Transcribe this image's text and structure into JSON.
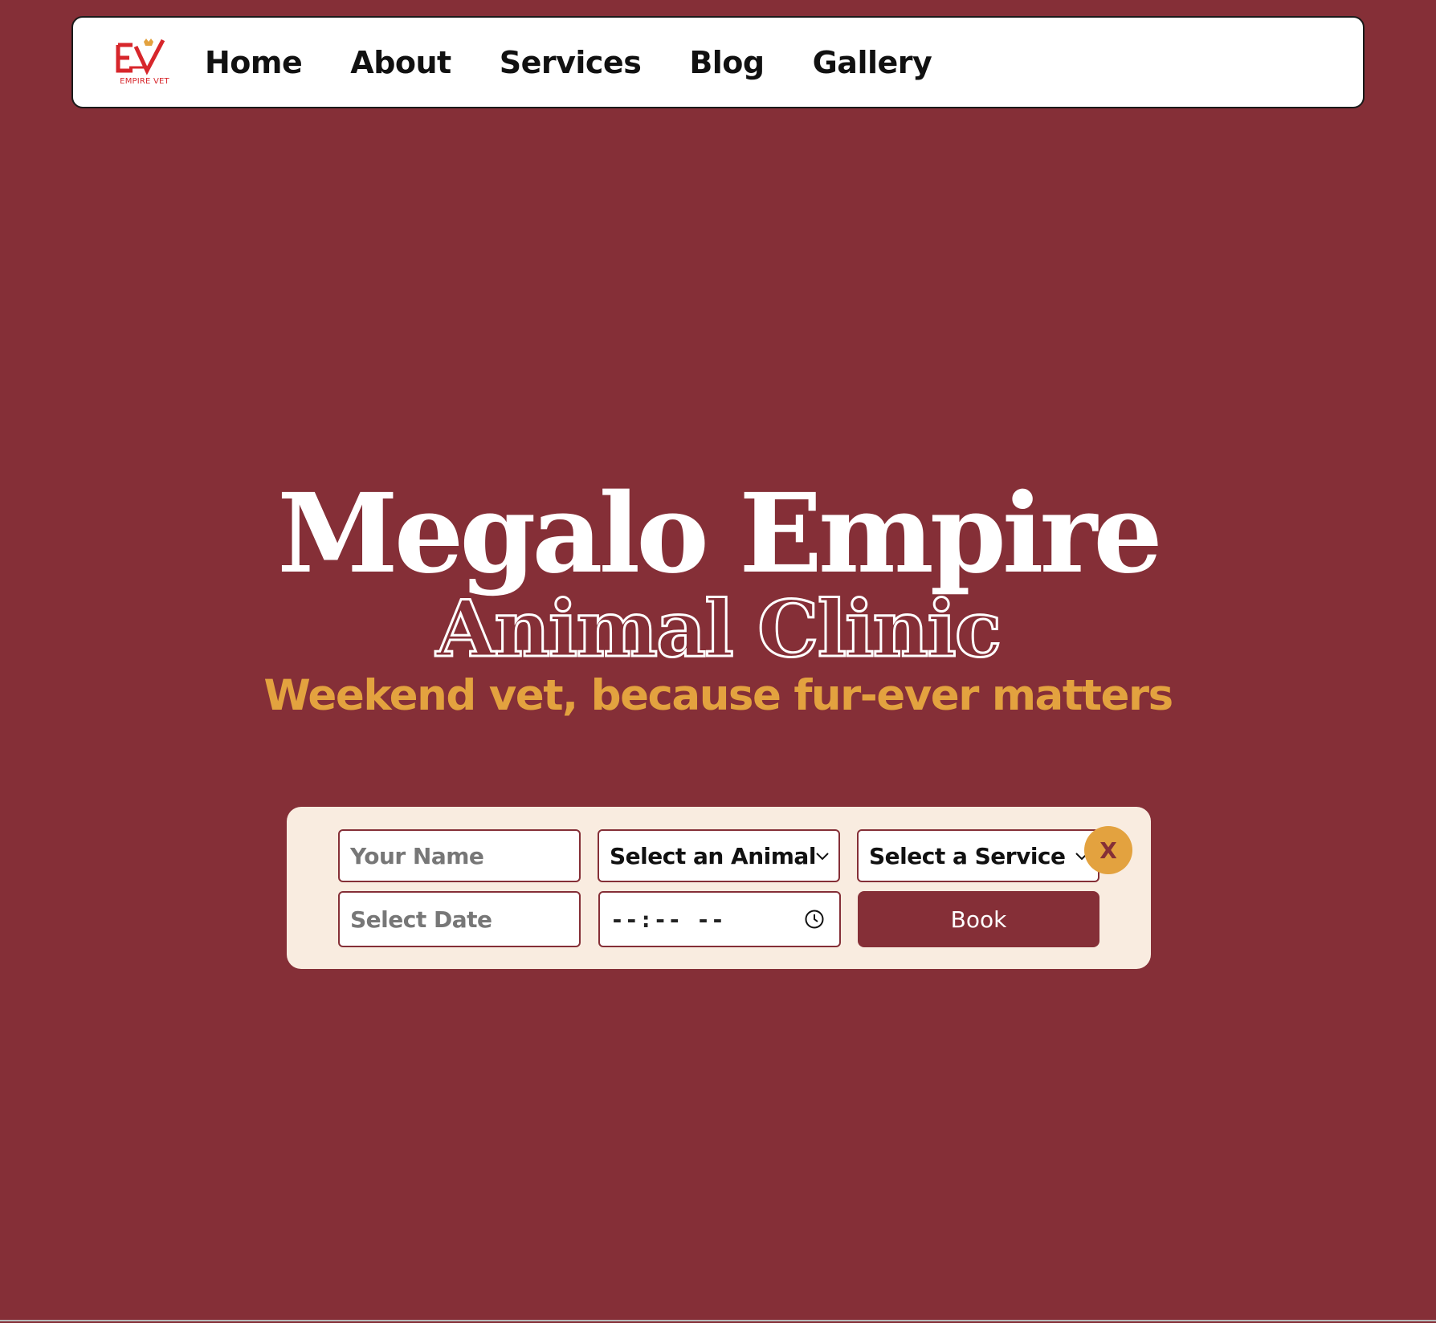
{
  "brand": {
    "logo_text": "EMPIRE VET",
    "primary_color": "#852f37",
    "accent_color": "#e3a23f",
    "logo_color": "#d7262b"
  },
  "nav": {
    "items": [
      {
        "label": "Home"
      },
      {
        "label": "About"
      },
      {
        "label": "Services"
      },
      {
        "label": "Blog"
      },
      {
        "label": "Gallery"
      }
    ]
  },
  "hero": {
    "title": "Megalo Empire",
    "subtitle": "Animal Clinic",
    "tagline": "Weekend vet, because fur-ever matters"
  },
  "booking": {
    "name_placeholder": "Your Name",
    "animal_select": "Select an Animal",
    "service_select": "Select a Service",
    "date_placeholder": "Select Date",
    "time_value": "--:-- --",
    "book_label": "Book",
    "close_label": "X"
  },
  "icons": {
    "logo": "empire-vet-logo",
    "chevron": "chevron-down-icon",
    "clock": "clock-icon"
  }
}
